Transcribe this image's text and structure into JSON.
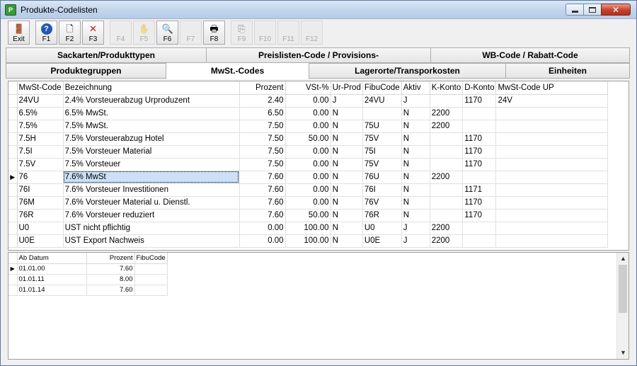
{
  "window": {
    "title": "Produkte-Codelisten",
    "app_icon_text": "P"
  },
  "toolbar": {
    "buttons": [
      {
        "label": "Exit",
        "icon": "exit-door-icon",
        "glyph": "🚪",
        "enabled": true
      },
      {
        "label": "F1",
        "icon": "help-icon",
        "glyph": "?",
        "enabled": true
      },
      {
        "label": "F2",
        "icon": "new-document-icon",
        "glyph": "🗋",
        "enabled": true
      },
      {
        "label": "F3",
        "icon": "delete-x-icon",
        "glyph": "✕",
        "enabled": true
      },
      {
        "label": "F4",
        "icon": "blank-icon",
        "glyph": "",
        "enabled": false
      },
      {
        "label": "F5",
        "icon": "hand-icon",
        "glyph": "✋",
        "enabled": false
      },
      {
        "label": "F6",
        "icon": "search-icon",
        "glyph": "🔍",
        "enabled": true
      },
      {
        "label": "F7",
        "icon": "blank-icon",
        "glyph": "",
        "enabled": false
      },
      {
        "label": "F8",
        "icon": "print-icon",
        "glyph": "🖶",
        "enabled": true
      },
      {
        "label": "F9",
        "icon": "copy-icon",
        "glyph": "⎘",
        "enabled": false
      },
      {
        "label": "F10",
        "icon": "blank-icon",
        "glyph": "",
        "enabled": false
      },
      {
        "label": "F11",
        "icon": "blank-icon",
        "glyph": "",
        "enabled": false
      },
      {
        "label": "F12",
        "icon": "blank-icon",
        "glyph": "",
        "enabled": false
      }
    ]
  },
  "tabs": {
    "row1": [
      "Sackarten/Produkttypen",
      "Preislisten-Code / Provisions-",
      "WB-Code / Rabatt-Code"
    ],
    "row2": [
      "Produktegruppen",
      "MwSt.-Codes",
      "Lagerorte/Transporkosten",
      "Einheiten"
    ],
    "active": "MwSt.-Codes"
  },
  "grid": {
    "columns": [
      "MwSt-Code",
      "Bezeichnung",
      "Prozent",
      "VSt-%",
      "Ur-Prod",
      "FibuCode",
      "Aktiv",
      "K-Konto",
      "D-Konto",
      "MwSt-Code UP"
    ],
    "rows": [
      [
        "24VU",
        "2.4% Vorsteuerabzug Urproduzent",
        "2.40",
        "0.00",
        "J",
        "24VU",
        "J",
        "",
        "1170",
        "24V"
      ],
      [
        "6.5%",
        "6.5% MwSt.",
        "6.50",
        "0.00",
        "N",
        "",
        "N",
        "2200",
        "",
        ""
      ],
      [
        "7.5%",
        "7.5% MwSt.",
        "7.50",
        "0.00",
        "N",
        "75U",
        "N",
        "2200",
        "",
        ""
      ],
      [
        "7.5H",
        "7.5% Vorsteuerabzug Hotel",
        "7.50",
        "50.00",
        "N",
        "75V",
        "N",
        "",
        "1170",
        ""
      ],
      [
        "7.5I",
        "7.5% Vorsteuer Material",
        "7.50",
        "0.00",
        "N",
        "75I",
        "N",
        "",
        "1170",
        ""
      ],
      [
        "7.5V",
        "7.5% Vorsteuer",
        "7.50",
        "0.00",
        "N",
        "75V",
        "N",
        "",
        "1170",
        ""
      ],
      [
        "76",
        "7.6% MwSt",
        "7.60",
        "0.00",
        "N",
        "76U",
        "N",
        "2200",
        "",
        ""
      ],
      [
        "76I",
        "7.6% Vorsteuer Investitionen",
        "7.60",
        "0.00",
        "N",
        "76I",
        "N",
        "",
        "1171",
        ""
      ],
      [
        "76M",
        "7.6% Vorsteuer Material u. Dienstl.",
        "7.60",
        "0.00",
        "N",
        "76V",
        "N",
        "",
        "1170",
        ""
      ],
      [
        "76R",
        "7.6% Vorsteuer reduziert",
        "7.60",
        "50.00",
        "N",
        "76R",
        "N",
        "",
        "1170",
        ""
      ],
      [
        "U0",
        "UST nicht pflichtig",
        "0.00",
        "100.00",
        "N",
        "U0",
        "J",
        "2200",
        "",
        ""
      ],
      [
        "U0E",
        "UST Export Nachweis",
        "0.00",
        "100.00",
        "N",
        "U0E",
        "J",
        "2200",
        "",
        ""
      ]
    ],
    "current_row": 6
  },
  "detail": {
    "columns": [
      "Ab Datum",
      "Prozent",
      "FibuCode"
    ],
    "rows": [
      [
        "01.01.00",
        "7.60",
        ""
      ],
      [
        "01.01.11",
        "8.00",
        ""
      ],
      [
        "01.01.14",
        "7.60",
        ""
      ]
    ],
    "current_row": 0
  }
}
